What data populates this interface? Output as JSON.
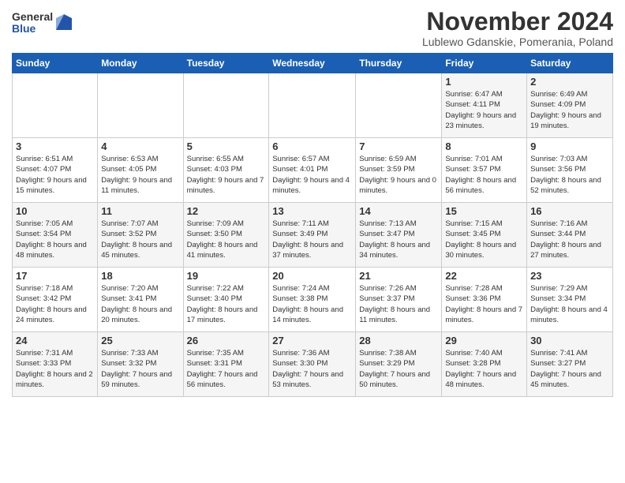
{
  "logo": {
    "general": "General",
    "blue": "Blue"
  },
  "title": "November 2024",
  "location": "Lublewo Gdanskie, Pomerania, Poland",
  "days_of_week": [
    "Sunday",
    "Monday",
    "Tuesday",
    "Wednesday",
    "Thursday",
    "Friday",
    "Saturday"
  ],
  "weeks": [
    [
      {
        "day": "",
        "info": ""
      },
      {
        "day": "",
        "info": ""
      },
      {
        "day": "",
        "info": ""
      },
      {
        "day": "",
        "info": ""
      },
      {
        "day": "",
        "info": ""
      },
      {
        "day": "1",
        "info": "Sunrise: 6:47 AM\nSunset: 4:11 PM\nDaylight: 9 hours and 23 minutes."
      },
      {
        "day": "2",
        "info": "Sunrise: 6:49 AM\nSunset: 4:09 PM\nDaylight: 9 hours and 19 minutes."
      }
    ],
    [
      {
        "day": "3",
        "info": "Sunrise: 6:51 AM\nSunset: 4:07 PM\nDaylight: 9 hours and 15 minutes."
      },
      {
        "day": "4",
        "info": "Sunrise: 6:53 AM\nSunset: 4:05 PM\nDaylight: 9 hours and 11 minutes."
      },
      {
        "day": "5",
        "info": "Sunrise: 6:55 AM\nSunset: 4:03 PM\nDaylight: 9 hours and 7 minutes."
      },
      {
        "day": "6",
        "info": "Sunrise: 6:57 AM\nSunset: 4:01 PM\nDaylight: 9 hours and 4 minutes."
      },
      {
        "day": "7",
        "info": "Sunrise: 6:59 AM\nSunset: 3:59 PM\nDaylight: 9 hours and 0 minutes."
      },
      {
        "day": "8",
        "info": "Sunrise: 7:01 AM\nSunset: 3:57 PM\nDaylight: 8 hours and 56 minutes."
      },
      {
        "day": "9",
        "info": "Sunrise: 7:03 AM\nSunset: 3:56 PM\nDaylight: 8 hours and 52 minutes."
      }
    ],
    [
      {
        "day": "10",
        "info": "Sunrise: 7:05 AM\nSunset: 3:54 PM\nDaylight: 8 hours and 48 minutes."
      },
      {
        "day": "11",
        "info": "Sunrise: 7:07 AM\nSunset: 3:52 PM\nDaylight: 8 hours and 45 minutes."
      },
      {
        "day": "12",
        "info": "Sunrise: 7:09 AM\nSunset: 3:50 PM\nDaylight: 8 hours and 41 minutes."
      },
      {
        "day": "13",
        "info": "Sunrise: 7:11 AM\nSunset: 3:49 PM\nDaylight: 8 hours and 37 minutes."
      },
      {
        "day": "14",
        "info": "Sunrise: 7:13 AM\nSunset: 3:47 PM\nDaylight: 8 hours and 34 minutes."
      },
      {
        "day": "15",
        "info": "Sunrise: 7:15 AM\nSunset: 3:45 PM\nDaylight: 8 hours and 30 minutes."
      },
      {
        "day": "16",
        "info": "Sunrise: 7:16 AM\nSunset: 3:44 PM\nDaylight: 8 hours and 27 minutes."
      }
    ],
    [
      {
        "day": "17",
        "info": "Sunrise: 7:18 AM\nSunset: 3:42 PM\nDaylight: 8 hours and 24 minutes."
      },
      {
        "day": "18",
        "info": "Sunrise: 7:20 AM\nSunset: 3:41 PM\nDaylight: 8 hours and 20 minutes."
      },
      {
        "day": "19",
        "info": "Sunrise: 7:22 AM\nSunset: 3:40 PM\nDaylight: 8 hours and 17 minutes."
      },
      {
        "day": "20",
        "info": "Sunrise: 7:24 AM\nSunset: 3:38 PM\nDaylight: 8 hours and 14 minutes."
      },
      {
        "day": "21",
        "info": "Sunrise: 7:26 AM\nSunset: 3:37 PM\nDaylight: 8 hours and 11 minutes."
      },
      {
        "day": "22",
        "info": "Sunrise: 7:28 AM\nSunset: 3:36 PM\nDaylight: 8 hours and 7 minutes."
      },
      {
        "day": "23",
        "info": "Sunrise: 7:29 AM\nSunset: 3:34 PM\nDaylight: 8 hours and 4 minutes."
      }
    ],
    [
      {
        "day": "24",
        "info": "Sunrise: 7:31 AM\nSunset: 3:33 PM\nDaylight: 8 hours and 2 minutes."
      },
      {
        "day": "25",
        "info": "Sunrise: 7:33 AM\nSunset: 3:32 PM\nDaylight: 7 hours and 59 minutes."
      },
      {
        "day": "26",
        "info": "Sunrise: 7:35 AM\nSunset: 3:31 PM\nDaylight: 7 hours and 56 minutes."
      },
      {
        "day": "27",
        "info": "Sunrise: 7:36 AM\nSunset: 3:30 PM\nDaylight: 7 hours and 53 minutes."
      },
      {
        "day": "28",
        "info": "Sunrise: 7:38 AM\nSunset: 3:29 PM\nDaylight: 7 hours and 50 minutes."
      },
      {
        "day": "29",
        "info": "Sunrise: 7:40 AM\nSunset: 3:28 PM\nDaylight: 7 hours and 48 minutes."
      },
      {
        "day": "30",
        "info": "Sunrise: 7:41 AM\nSunset: 3:27 PM\nDaylight: 7 hours and 45 minutes."
      }
    ]
  ]
}
